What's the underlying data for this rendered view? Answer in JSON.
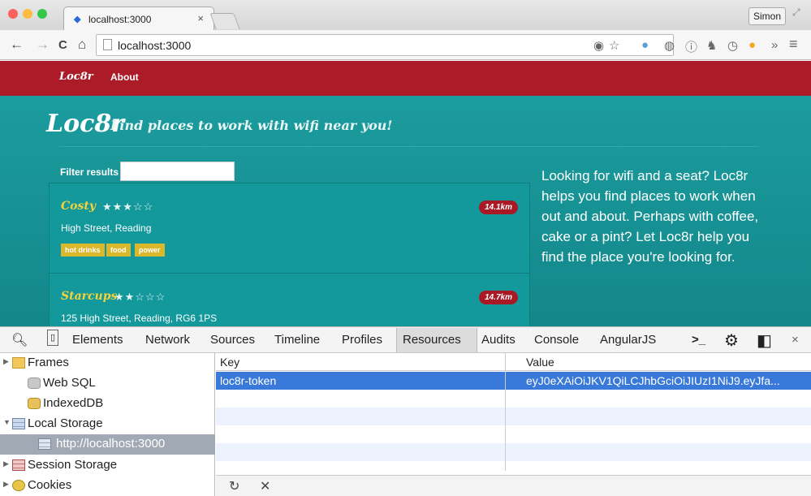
{
  "window": {
    "tab_title": "localhost:3000",
    "tab_close": "×",
    "user_name": "Simon",
    "traffic_colors": [
      "#fc615d",
      "#fdbc40",
      "#34c84a"
    ]
  },
  "toolbar": {
    "url": "localhost:3000",
    "back_icon": "←",
    "forward_icon": "→",
    "reload_icon": "C",
    "home_icon": "⌂",
    "overflow": "»",
    "menu_icon": "≡"
  },
  "site": {
    "brand": "Loc8r",
    "nav_about": "About",
    "logo": "Loc8r",
    "tagline": "Find places to work with wifi near you!",
    "filter_label": "Filter results",
    "filter_value": "",
    "blurb": "Looking for wifi and a seat? Loc8r helps you find places to work when out and about. Perhaps with coffee, cake or a pint? Let Loc8r help you find the place you're looking for.",
    "locations": [
      {
        "name": "Costy",
        "rating": 3,
        "stars": "★★★☆☆",
        "distance": "14.1km",
        "address": "High Street, Reading",
        "facilities": [
          "hot drinks",
          "food",
          "power"
        ]
      },
      {
        "name": "Starcups",
        "rating": 2,
        "stars": "★★☆☆☆",
        "distance": "14.7km",
        "address": "125 High Street, Reading, RG6 1PS",
        "facilities": []
      }
    ],
    "colors": {
      "nav": "#ac1c28",
      "teal": "#1b9c9e",
      "gold": "#f2d33c"
    }
  },
  "devtools": {
    "tabs": [
      "Elements",
      "Network",
      "Sources",
      "Timeline",
      "Profiles",
      "Resources",
      "Audits",
      "Console",
      "AngularJS"
    ],
    "active_tab": "Resources",
    "sidebar": [
      {
        "label": "Frames",
        "arrow": "▶"
      },
      {
        "label": "Web SQL",
        "arrow": ""
      },
      {
        "label": "IndexedDB",
        "arrow": ""
      },
      {
        "label": "Local Storage",
        "arrow": "▼"
      },
      {
        "label": "http://localhost:3000",
        "arrow": ""
      },
      {
        "label": "Session Storage",
        "arrow": "▶"
      },
      {
        "label": "Cookies",
        "arrow": "▶"
      }
    ],
    "columns": {
      "key": "Key",
      "value": "Value"
    },
    "rows": [
      {
        "key": "loc8r-token",
        "value": "eyJ0eXAiOiJKV1QiLCJhbGciOiJIUzI1NiJ9.eyJfa..."
      }
    ],
    "refresh_icon": "↻",
    "delete_icon": "✕",
    "selected_color": "#3879d9"
  }
}
